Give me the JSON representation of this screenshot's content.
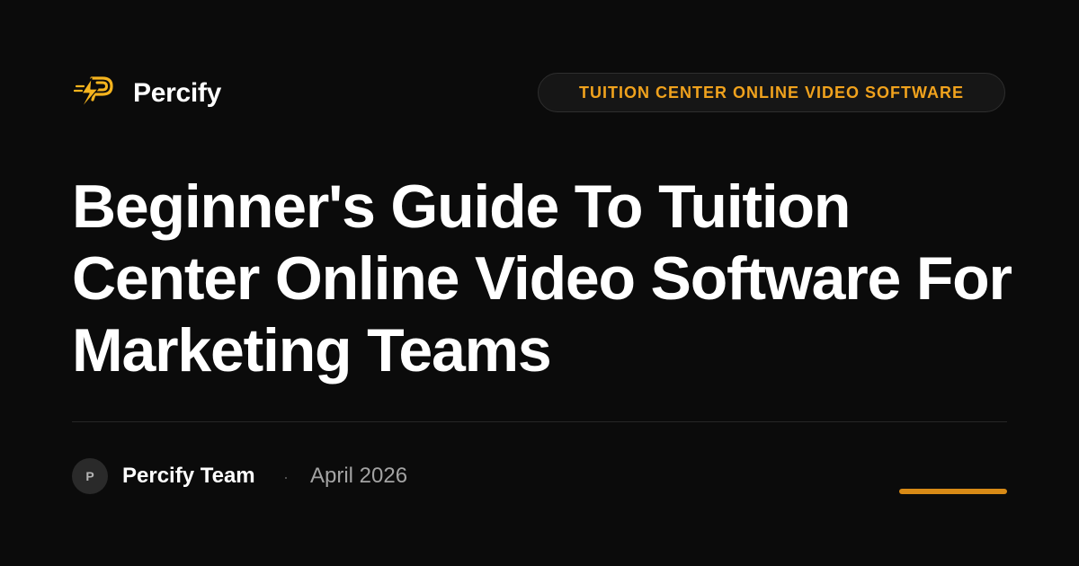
{
  "brand": {
    "name": "Percify",
    "logo_icon": "lightning-p-logo-icon",
    "logo_color": "#f5b41e"
  },
  "category": {
    "label": "TUITION CENTER ONLINE VIDEO SOFTWARE"
  },
  "article": {
    "title": "Beginner's Guide To Tuition Center Online Video Software For Marketing Teams"
  },
  "meta": {
    "avatar_initial": "P",
    "author": "Percify Team",
    "separator": "·",
    "date": "April 2026"
  },
  "colors": {
    "background": "#0b0b0b",
    "accent": "#f0a21d",
    "accent_bar": "#d88a16",
    "text_primary": "#ffffff",
    "text_muted": "#a3a3a3"
  }
}
